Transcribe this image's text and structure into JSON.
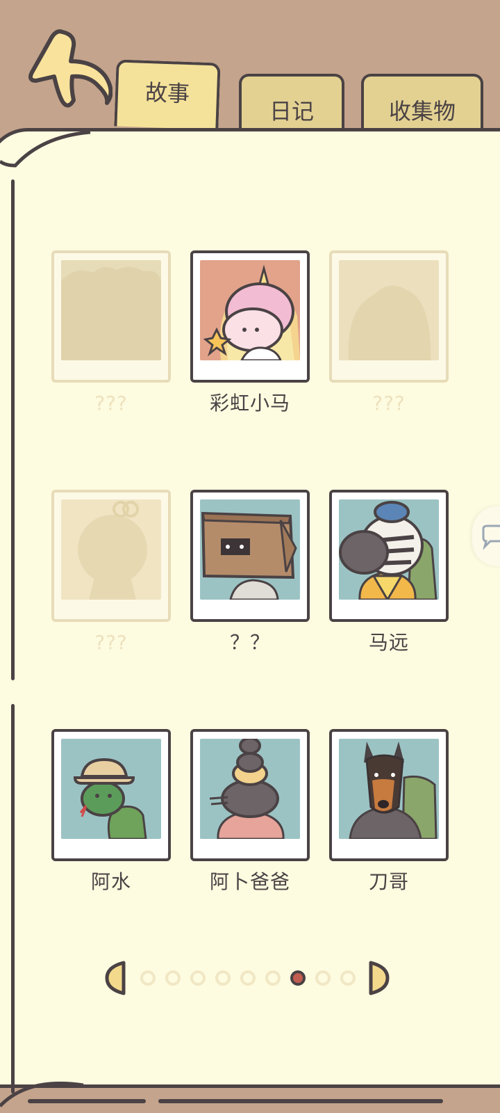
{
  "tabs": {
    "story": "故事",
    "diary": "日记",
    "collection": "收集物"
  },
  "characters": [
    {
      "name": "???",
      "locked": true
    },
    {
      "name": "彩虹小马",
      "locked": false
    },
    {
      "name": "???",
      "locked": true
    },
    {
      "name": "???",
      "locked": true
    },
    {
      "name": "？？",
      "locked": false
    },
    {
      "name": "马远",
      "locked": false
    },
    {
      "name": "阿水",
      "locked": false
    },
    {
      "name": "阿卜爸爸",
      "locked": false
    },
    {
      "name": "刀哥",
      "locked": false
    }
  ],
  "pager": {
    "total": 9,
    "current": 7
  },
  "colors": {
    "outline": "#4a4244",
    "paper": "#fdfbe0",
    "background": "#c4a48c",
    "tab": "#f4e29a",
    "active_dot": "#c25d52",
    "locked_text": "#ede2be"
  }
}
